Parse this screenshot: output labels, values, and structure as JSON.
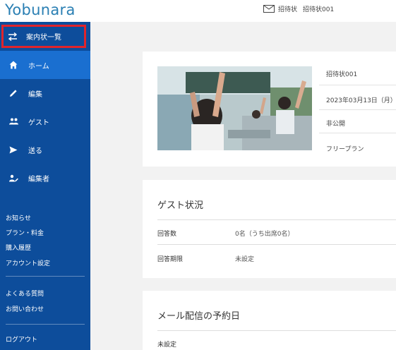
{
  "header": {
    "logo": "Yobunara",
    "breadcrumb_icon": "mail-icon",
    "breadcrumb_1": "招待状",
    "breadcrumb_2": "招待状001"
  },
  "colors": {
    "sidebar_bg": "#0d4d9b",
    "sidebar_active": "#1a6fd0",
    "highlight_border": "#e0242b",
    "logo": "#2a7fb3"
  },
  "sidebar": {
    "nav": [
      {
        "label": "案内状一覧",
        "icon": "swap-arrows-icon"
      },
      {
        "label": "ホーム",
        "icon": "home-icon"
      },
      {
        "label": "編集",
        "icon": "pencil-icon"
      },
      {
        "label": "ゲスト",
        "icon": "people-icon"
      },
      {
        "label": "送る",
        "icon": "send-icon"
      },
      {
        "label": "編集者",
        "icon": "person-edit-icon"
      }
    ],
    "links": [
      "お知らせ",
      "プラン・料金",
      "購入履歴",
      "アカウント設定"
    ],
    "help": [
      "よくある質問",
      "お問い合わせ"
    ],
    "logout": "ログアウト"
  },
  "invitation": {
    "title": "招待状001",
    "date": "2023年03月13日（月）",
    "visibility": "非公開",
    "plan": "フリープラン"
  },
  "guest_status": {
    "title": "ゲスト状況",
    "rows": [
      {
        "label": "回答数",
        "value": "0名（うち出席0名）"
      },
      {
        "label": "回答期限",
        "value": "未設定"
      }
    ]
  },
  "mail_schedule": {
    "title": "メール配信の予約日",
    "value": "未設定"
  }
}
